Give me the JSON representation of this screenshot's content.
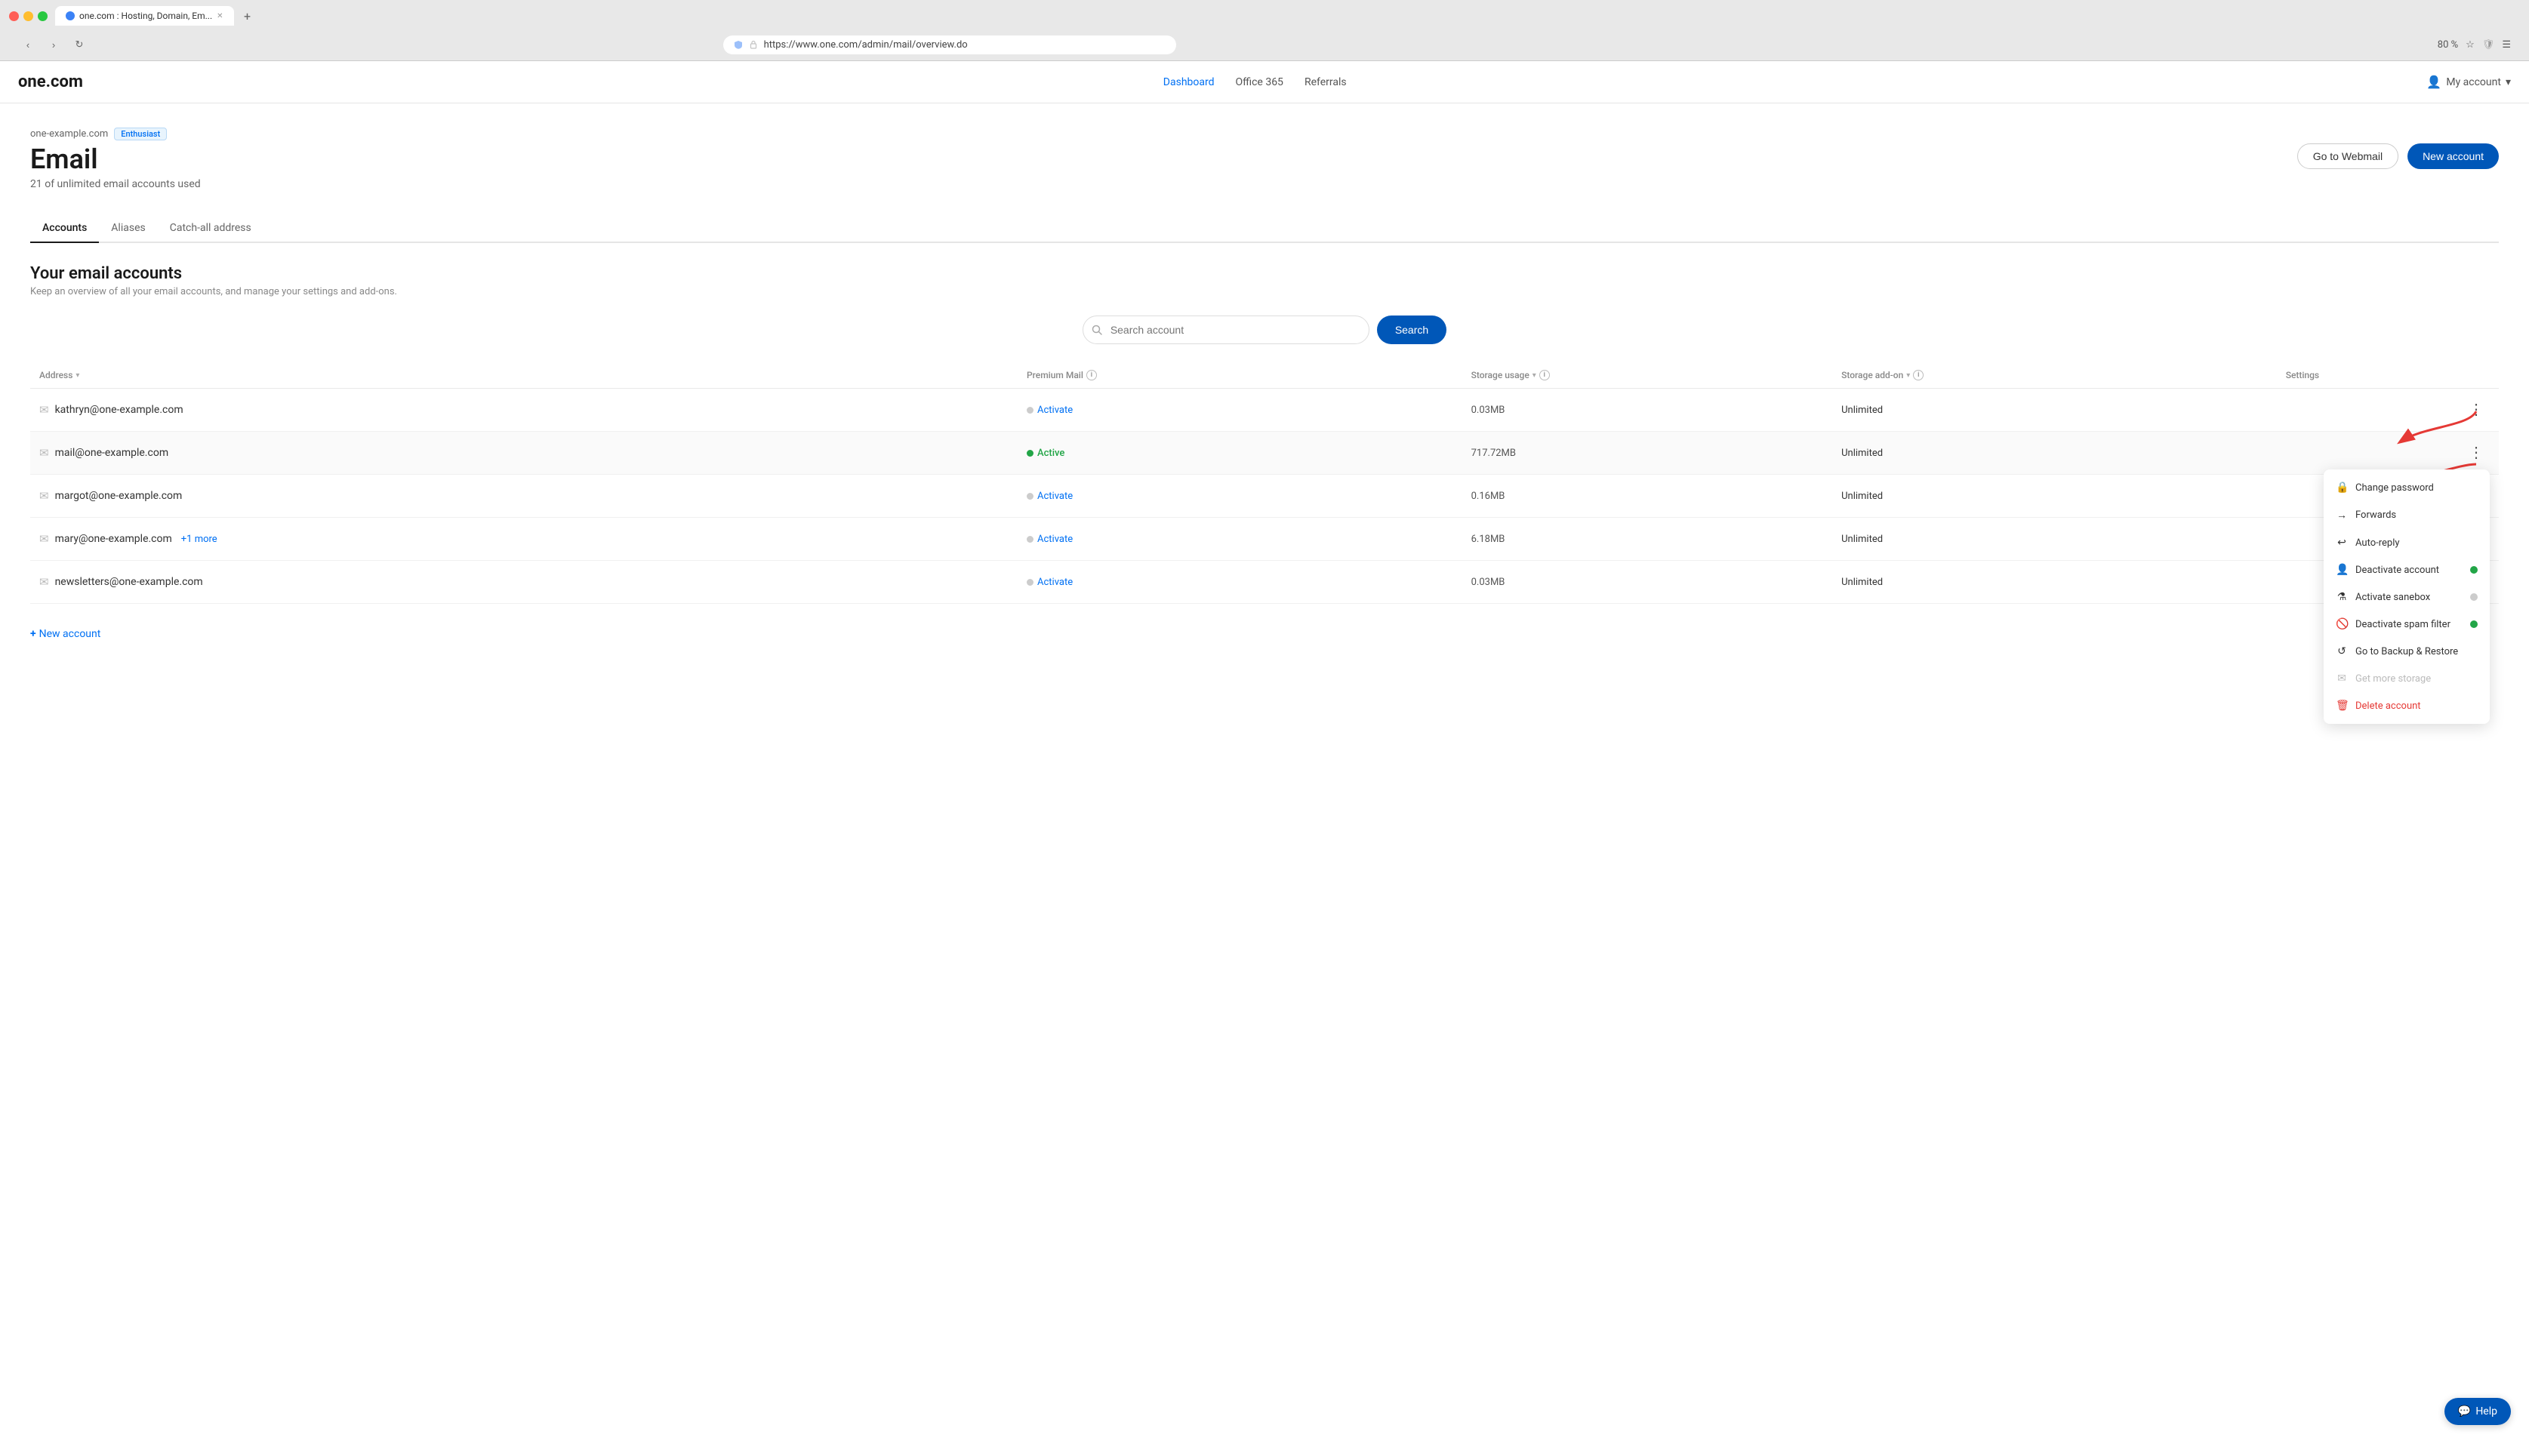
{
  "browser": {
    "url": "https://www.one.com/admin/mail/overview.do",
    "tab_title": "one.com : Hosting, Domain, Em...",
    "zoom": "80 %"
  },
  "nav": {
    "logo": "one.com",
    "links": [
      {
        "label": "Dashboard",
        "active": true
      },
      {
        "label": "Office 365",
        "active": false
      },
      {
        "label": "Referrals",
        "active": false
      }
    ],
    "my_account": "My account"
  },
  "page": {
    "domain": "one-example.com",
    "badge": "Enthusiast",
    "title": "Email",
    "subtitle": "21 of unlimited email accounts used",
    "btn_webmail": "Go to Webmail",
    "btn_new_account": "New account"
  },
  "tabs": [
    {
      "label": "Accounts",
      "active": true
    },
    {
      "label": "Aliases",
      "active": false
    },
    {
      "label": "Catch-all address",
      "active": false
    }
  ],
  "accounts_section": {
    "title": "Your email accounts",
    "desc": "Keep an overview of all your email accounts, and manage your settings and add-ons.",
    "search_placeholder": "Search account",
    "search_btn": "Search"
  },
  "table": {
    "columns": [
      {
        "label": "Address",
        "sortable": true
      },
      {
        "label": "Premium Mail",
        "info": true
      },
      {
        "label": "Storage usage",
        "info": true,
        "sortable": true
      },
      {
        "label": "Storage add-on",
        "info": true,
        "sortable": true
      },
      {
        "label": "Settings"
      }
    ],
    "rows": [
      {
        "address": "kathryn@one-example.com",
        "premium_status": "Activate",
        "premium_active": false,
        "storage": "0.03MB",
        "addon": "Unlimited",
        "menu_open": false
      },
      {
        "address": "mail@one-example.com",
        "premium_status": "Active",
        "premium_active": true,
        "storage": "717.72MB",
        "addon": "Unlimited",
        "menu_open": true
      },
      {
        "address": "margot@one-example.com",
        "extra": "",
        "premium_status": "Activate",
        "premium_active": false,
        "storage": "0.16MB",
        "addon": "U...",
        "menu_open": false
      },
      {
        "address": "mary@one-example.com",
        "extra": "+1 more",
        "premium_status": "Activate",
        "premium_active": false,
        "storage": "6.18MB",
        "addon": "U...",
        "menu_open": false
      },
      {
        "address": "newsletters@one-example.com",
        "extra": "",
        "premium_status": "Activate",
        "premium_active": false,
        "storage": "0.03MB",
        "addon": "U...",
        "menu_open": false
      }
    ],
    "new_account_link": "New account"
  },
  "dropdown": {
    "items": [
      {
        "label": "Change password",
        "icon": "lock",
        "indicator": null,
        "danger": false,
        "disabled": false
      },
      {
        "label": "Forwards",
        "icon": "arrow-right",
        "indicator": null,
        "danger": false,
        "disabled": false
      },
      {
        "label": "Auto-reply",
        "icon": "arrow-left",
        "indicator": null,
        "danger": false,
        "disabled": false
      },
      {
        "label": "Deactivate account",
        "icon": "person",
        "indicator": "green",
        "danger": false,
        "disabled": false
      },
      {
        "label": "Activate sanebox",
        "icon": "funnel",
        "indicator": "gray",
        "danger": false,
        "disabled": false
      },
      {
        "label": "Deactivate spam filter",
        "icon": "block",
        "indicator": "green",
        "danger": false,
        "disabled": false
      },
      {
        "label": "Go to Backup & Restore",
        "icon": "restore",
        "indicator": null,
        "danger": false,
        "disabled": false
      },
      {
        "label": "Get more storage",
        "icon": "envelope",
        "indicator": null,
        "danger": false,
        "disabled": true
      },
      {
        "label": "Delete account",
        "icon": "trash",
        "indicator": null,
        "danger": true,
        "disabled": false
      }
    ]
  },
  "help": {
    "label": "Help"
  }
}
